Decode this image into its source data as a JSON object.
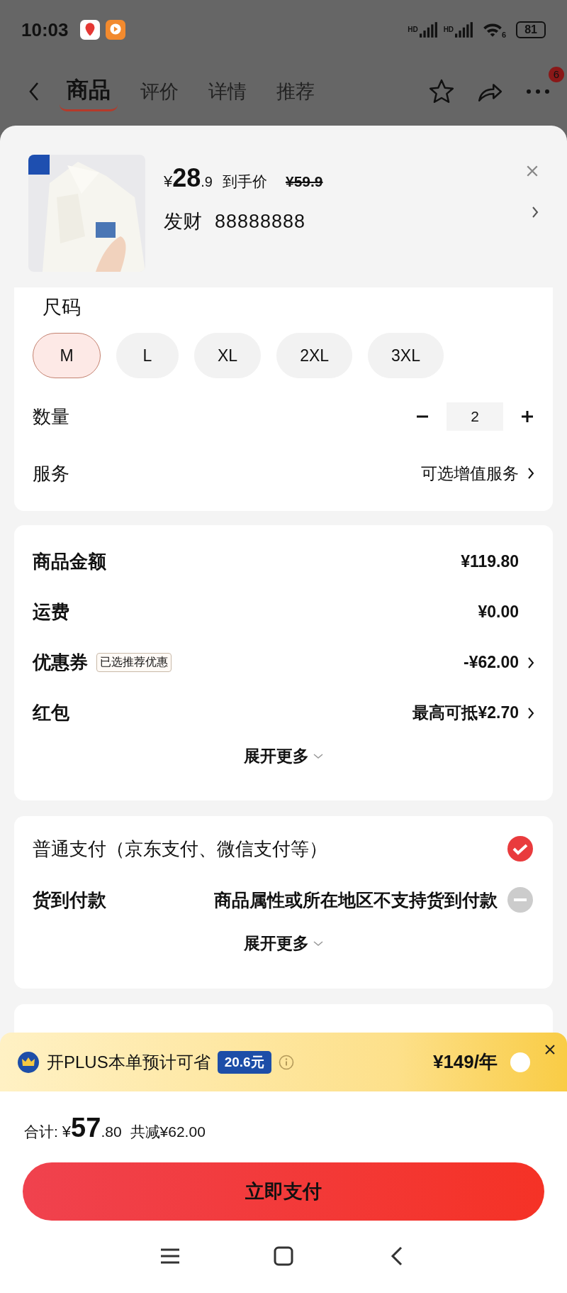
{
  "status_bar": {
    "time": "10:03",
    "signal_labels": [
      "HD",
      "HD"
    ],
    "wifi_label": "6",
    "battery": "81"
  },
  "nav": {
    "tabs": [
      {
        "label": "商品",
        "selected": true
      },
      {
        "label": "评价",
        "selected": false
      },
      {
        "label": "详情",
        "selected": false
      },
      {
        "label": "推荐",
        "selected": false
      }
    ],
    "more_badge": "6"
  },
  "product": {
    "price_symbol": "¥",
    "price_int": "28",
    "price_dec": ".9",
    "price_label": "到手价",
    "original_price": "¥59.9",
    "spec_name": "发财",
    "spec_code": "88888888"
  },
  "size": {
    "title": "尺码",
    "options": [
      {
        "label": "M",
        "selected": true
      },
      {
        "label": "L",
        "selected": false
      },
      {
        "label": "XL",
        "selected": false
      },
      {
        "label": "2XL",
        "selected": false
      },
      {
        "label": "3XL",
        "selected": false
      }
    ]
  },
  "quantity": {
    "label": "数量",
    "value": "2"
  },
  "service": {
    "label": "服务",
    "value": "可选增值服务"
  },
  "costs": {
    "rows": [
      {
        "label": "商品金额",
        "value": "¥119.80",
        "arrow": false
      },
      {
        "label": "运费",
        "value": "¥0.00",
        "arrow": false
      },
      {
        "label": "优惠券",
        "tag": "已选推荐优惠",
        "value": "-¥62.00",
        "arrow": true
      },
      {
        "label": "红包",
        "value": "最高可抵¥2.70",
        "arrow": true
      }
    ],
    "expand": "展开更多"
  },
  "payment": {
    "options": [
      {
        "kind": "available",
        "label": "普通支付（京东支付、微信支付等）",
        "selected": true
      },
      {
        "kind": "unavailable",
        "label": "货到付款",
        "note": "商品属性或所在地区不支持货到付款",
        "selected": false
      }
    ],
    "expand": "展开更多"
  },
  "plus": {
    "text": "开PLUS本单预计可省",
    "savings": "20.6元",
    "price": "¥149/年",
    "selected": false
  },
  "total": {
    "label": "合计:",
    "symbol": "¥",
    "int": "57",
    "dec": ".80",
    "discount": "共减¥62.00"
  },
  "pay_button": "立即支付"
}
